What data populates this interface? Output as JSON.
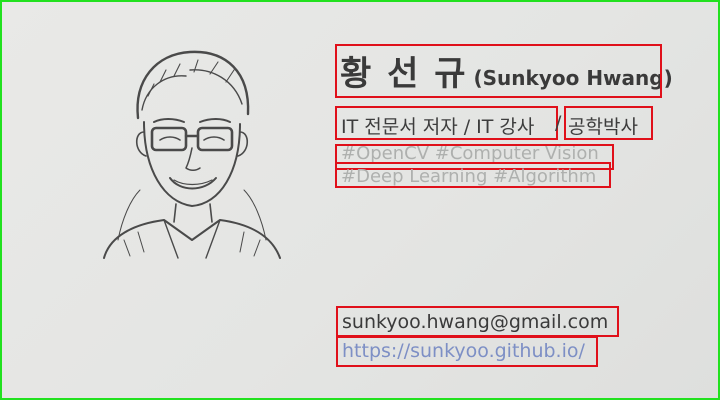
{
  "profile": {
    "name_ko": "황 선 규",
    "name_en": "(Sunkyoo Hwang)",
    "role_primary": "IT 전문서 저자 / IT 강사",
    "role_separator": "/",
    "role_degree": "공학박사",
    "tags_line1": "#OpenCV #Computer Vision",
    "tags_line2": "#Deep Learning #Algorithm",
    "email": "sunkyoo.hwang@gmail.com",
    "website": "https://sunkyoo.github.io/"
  },
  "colors": {
    "frame_border": "#22e11f",
    "highlight_box": "#e0101a",
    "background": "#e6e7e5",
    "link": "#7d8fc5",
    "tag_text": "#aeb0ae"
  },
  "icons": {
    "portrait": "person-sketch-portrait"
  }
}
